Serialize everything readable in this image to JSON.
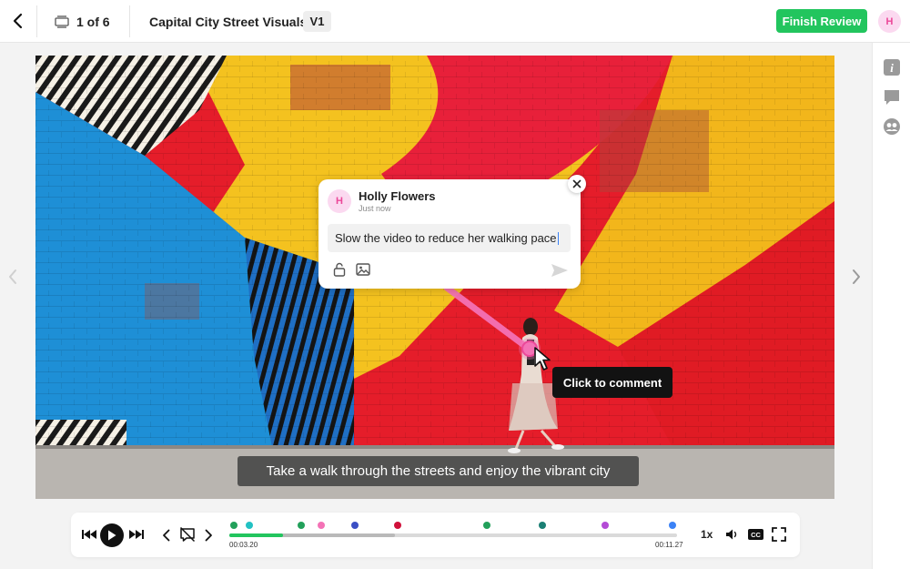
{
  "header": {
    "counter": "1 of 6",
    "title": "Capital City Street Visuals",
    "version": "V1",
    "finish_label": "Finish Review",
    "avatar_initial": "H"
  },
  "icons": {
    "back": "chevron-left-icon",
    "assets": "stack-icon",
    "info": "info-icon",
    "comments": "comment-icon",
    "reviewers": "users-icon",
    "prev": "chevron-left-icon",
    "next": "chevron-right-icon"
  },
  "colors": {
    "accent": "#22c55e",
    "pin": "#ec4899",
    "avatar_bg": "#fbd9f0"
  },
  "comment": {
    "author_initial": "H",
    "author": "Holly Flowers",
    "time": "Just now",
    "text": "Slow the video to reduce her walking pace"
  },
  "tooltip": "Click to comment",
  "subtitle": "Take a walk through the streets and enjoy the vibrant city",
  "player": {
    "current_time": "00:03.20",
    "duration": "00:11.27",
    "speed": "1x",
    "cc_label": "CC",
    "progress_fraction": 0.12,
    "buffered_fraction": 0.37,
    "markers": [
      {
        "position": 0.01,
        "color": "#22a05a"
      },
      {
        "position": 0.045,
        "color": "#22c1c3"
      },
      {
        "position": 0.16,
        "color": "#22a05a"
      },
      {
        "position": 0.205,
        "color": "#f472b6"
      },
      {
        "position": 0.28,
        "color": "#3b4fc4"
      },
      {
        "position": 0.375,
        "color": "#d0103a"
      },
      {
        "position": 0.575,
        "color": "#22a05a"
      },
      {
        "position": 0.7,
        "color": "#1a7f74"
      },
      {
        "position": 0.84,
        "color": "#b44bd6"
      },
      {
        "position": 0.99,
        "color": "#3b82f6"
      }
    ]
  }
}
